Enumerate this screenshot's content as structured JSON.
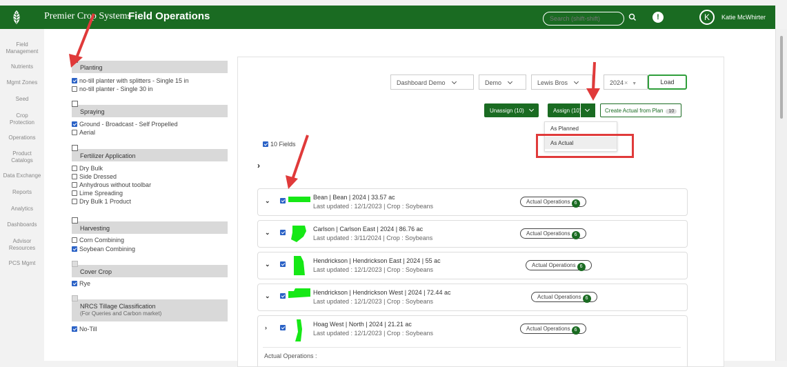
{
  "header": {
    "brand": "Premier Crop Systems",
    "title": "Field Operations",
    "search_placeholder": "Search (shift-shift)",
    "avatar_initial": "K",
    "user_name": "Katie McWhirter",
    "alert_glyph": "!",
    "colors": {
      "bar": "#1a6b22",
      "text": "#ffffff"
    }
  },
  "nav": [
    {
      "label": "Field\nManagement"
    },
    {
      "label": "Nutrients"
    },
    {
      "label": "Mgmt Zones"
    },
    {
      "label": "Seed"
    },
    {
      "label": "Crop\nProtection"
    },
    {
      "label": "Operations"
    },
    {
      "label": "Product\nCatalogs"
    },
    {
      "label": "Data Exchange"
    },
    {
      "label": "Reports"
    },
    {
      "label": "Analytics"
    },
    {
      "label": "Dashboards"
    },
    {
      "label": "Advisor\nResources"
    },
    {
      "label": "PCS Mgmt"
    }
  ],
  "filters": {
    "planting": {
      "label": "Planting",
      "checked": false,
      "options": [
        {
          "label": "no-till planter with splitters - Single 15 in",
          "checked": true
        },
        {
          "label": "no-till planter - Single 30 in",
          "checked": false
        }
      ]
    },
    "spraying": {
      "label": "Spraying",
      "checked": false,
      "options": [
        {
          "label": "Ground - Broadcast - Self Propelled",
          "checked": true
        },
        {
          "label": "Aerial",
          "checked": false
        }
      ]
    },
    "fertilizer": {
      "label": "Fertilizer Application",
      "checked": false,
      "options": [
        {
          "label": "Dry Bulk",
          "checked": false
        },
        {
          "label": "Side Dressed",
          "checked": false
        },
        {
          "label": "Anhydrous without toolbar",
          "checked": false
        },
        {
          "label": "Lime Spreading",
          "checked": false
        },
        {
          "label": "Dry Bulk 1 Product",
          "checked": false
        }
      ]
    },
    "harvesting": {
      "label": "Harvesting",
      "checked": false,
      "options": [
        {
          "label": "Corn Combining",
          "checked": false
        },
        {
          "label": "Soybean Combining",
          "checked": true
        }
      ]
    },
    "cover_crop": {
      "label": "Cover Crop",
      "checked": false,
      "options": [
        {
          "label": "Rye",
          "checked": true
        }
      ]
    },
    "nrcs": {
      "label": "NRCS Tillage Classification",
      "sub": "(For Queries and Carbon market)",
      "checked": false,
      "options": [
        {
          "label": "No-Till",
          "checked": true
        }
      ]
    }
  },
  "toolbar": {
    "dashboard_select": "Dashboard Demo",
    "client_select": "Demo",
    "farm_select": "Lewis Bros",
    "year_select": "2024",
    "year_clear": "×",
    "load_label": "Load",
    "unassign_label": "Unassign (10)",
    "assign_label": "Assign (10)",
    "create_actual_label": "Create Actual from Plan",
    "create_actual_count": "10"
  },
  "assign_menu": {
    "items": [
      {
        "label": "As Planned"
      },
      {
        "label": "As Actual"
      }
    ]
  },
  "fields_header": {
    "label": "10 Fields",
    "checked": true,
    "expand_glyph": "›"
  },
  "field_rows": [
    {
      "title": "Bean | Bean | 2024 | 33.57 ac",
      "updated": "Last updated : 12/1/2023 | Crop : Soybeans",
      "badge": "Actual Operations",
      "count": "6",
      "caret": "⌄",
      "checked": true
    },
    {
      "title": "Carlson | Carlson East | 2024 | 86.76 ac",
      "updated": "Last updated : 3/11/2024 | Crop : Soybeans",
      "badge": "Actual Operations",
      "count": "6",
      "caret": "⌄",
      "checked": true
    },
    {
      "title": "Hendrickson | Hendrickson East | 2024 | 55 ac",
      "updated": "Last updated : 12/1/2023 | Crop : Soybeans",
      "badge": "Actual Operations",
      "count": "6",
      "caret": "⌄",
      "checked": true
    },
    {
      "title": "Hendrickson | Hendrickson West | 2024 | 72.44 ac",
      "updated": "Last updated : 12/1/2023 | Crop : Soybeans",
      "badge": "Actual Operations",
      "count": "6",
      "caret": "⌄",
      "checked": true
    },
    {
      "title": "Hoag West | North | 2024 | 21.21 ac",
      "updated": "Last updated : 12/1/2023 | Crop : Soybeans",
      "badge": "Actual Operations",
      "count": "6",
      "caret": "›",
      "checked": true
    }
  ],
  "expanded_section": {
    "label": "Actual Operations :"
  },
  "annotation_color": "#e03a3a",
  "field_color": "#16e816"
}
